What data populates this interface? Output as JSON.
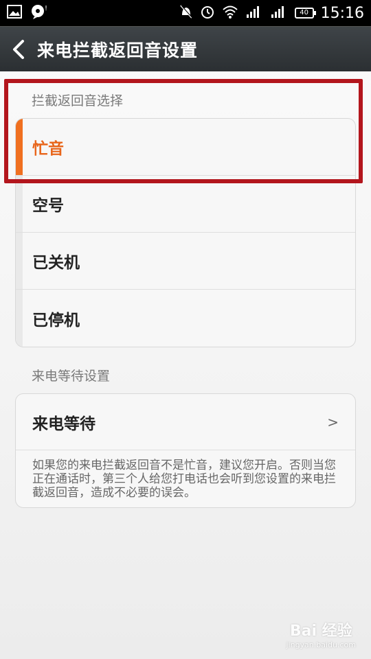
{
  "status_bar": {
    "time": "15:16",
    "battery": "40"
  },
  "header": {
    "title": "来电拦截返回音设置"
  },
  "section1": {
    "header": "拦截返回音选择",
    "options": [
      {
        "label": "忙音",
        "selected": true
      },
      {
        "label": "空号",
        "selected": false
      },
      {
        "label": "已关机",
        "selected": false
      },
      {
        "label": "已停机",
        "selected": false
      }
    ]
  },
  "section2": {
    "header": "来电等待设置",
    "item_label": "来电等待",
    "chevron": ">",
    "description": "如果您的来电拦截返回音不是忙音，建议您开启。否则当您正在通话时，第三个人给您打电话也会听到您设置的来电拦截返回音，造成不必要的误会。"
  },
  "watermark": {
    "logo": "Bai 经验",
    "url": "jingyan.baidu.com"
  },
  "colors": {
    "accent": "#f07020",
    "highlight": "#b3161d"
  }
}
